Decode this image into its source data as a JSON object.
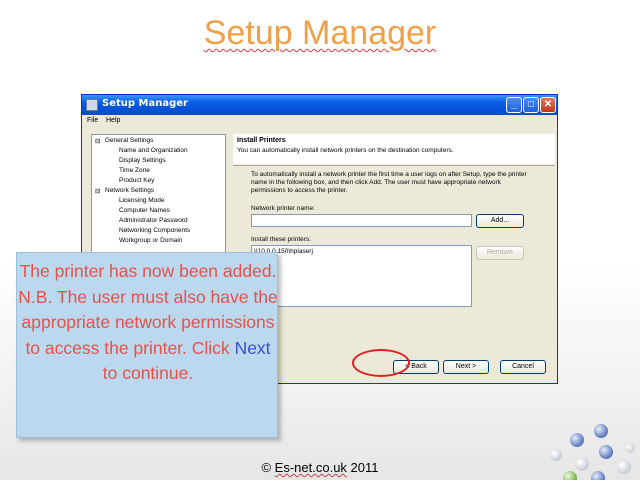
{
  "slide": {
    "title": "Setup Manager",
    "footer_prefix": "© ",
    "footer_link": "Es-net.co.uk",
    "footer_suffix": " 2011"
  },
  "window": {
    "title": "Setup Manager",
    "minimize_glyph": "_",
    "maximize_glyph": "□",
    "close_glyph": "✕",
    "menu": {
      "file": "File",
      "help": "Help"
    }
  },
  "tree": {
    "items": [
      "General Settings",
      "Name and Organization",
      "Display Settings",
      "Time Zone",
      "Product Key",
      "Network Settings",
      "Licensing Mode",
      "Computer Names",
      "Administrator Password",
      "Networking Components",
      "Workgroup or Domain"
    ],
    "expander": "⊟"
  },
  "page": {
    "header_title": "Install Printers",
    "header_subtitle": "You can automatically install network printers on the destination computers.",
    "description": "To automatically install a network printer the first time a user logs on after Setup, type the printer name in the following box, and then click Add. The user must have appropriate network permissions to access the printer.",
    "network_printer_label": "Network printer name:",
    "network_printer_value": "",
    "install_label": "Install these printers:",
    "installed_printers": [
      "\\\\10.0.0.150\\hplaserj"
    ],
    "add_button": "Add...",
    "remove_button": "Remove"
  },
  "footer_buttons": {
    "back": "< Back",
    "next": "Next >",
    "cancel": "Cancel"
  },
  "callout": {
    "text_before": "The printer has now been added. N.B. The user must also have the appropriate network permissions to access the printer. Click ",
    "keyword": "Next",
    "text_after": " to continue."
  },
  "colors": {
    "title_orange": "#f0a048",
    "callout_bg": "#bcd8ee",
    "callout_text": "#e3534a",
    "keyword_blue": "#3b4fcf",
    "highlight_red": "#e02020",
    "xp_blue": "#0a5fe6"
  }
}
